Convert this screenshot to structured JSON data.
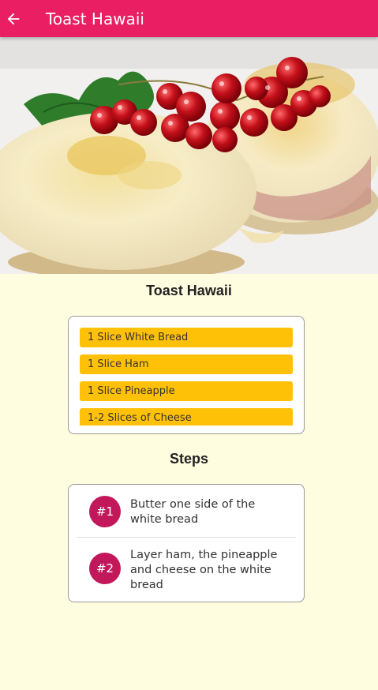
{
  "app_bar": {
    "title": "Toast Hawaii",
    "back_icon": "arrow-left-icon",
    "color": "#e91e63"
  },
  "hero_image": {
    "description_icon": "food-photo"
  },
  "recipe": {
    "title": "Toast Hawaii",
    "ingredients": [
      "1 Slice White Bread",
      "1 Slice Ham",
      "1 Slice Pineapple",
      "1-2 Slices of Cheese"
    ]
  },
  "steps_section": {
    "title": "Steps",
    "steps": [
      {
        "badge": "#1",
        "text": "Butter one side of the white bread"
      },
      {
        "badge": "#2",
        "text": "Layer ham, the pineapple and cheese on the white bread"
      }
    ]
  },
  "colors": {
    "background": "#fffde0",
    "ingredient_chip": "#ffc107",
    "step_badge": "#c2185b"
  }
}
